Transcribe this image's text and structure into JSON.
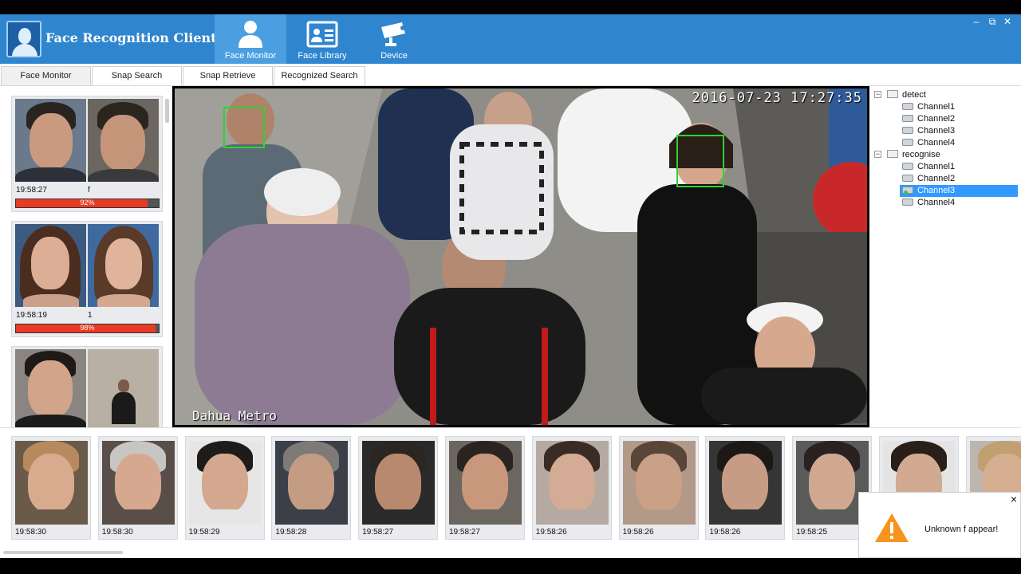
{
  "app": {
    "title": "Face Recognition Client"
  },
  "nav": [
    {
      "label": "Face Monitor",
      "icon": "person-icon",
      "active": true
    },
    {
      "label": "Face Library",
      "icon": "id-card-icon",
      "active": false
    },
    {
      "label": "Device",
      "icon": "camera-icon",
      "active": false
    }
  ],
  "window_controls": {
    "minimize": "–",
    "restore": "⧉",
    "close": "✕"
  },
  "tabs": [
    "Face Monitor",
    "Snap Search",
    "Snap Retrieve",
    "Recognized Search"
  ],
  "recognitions": [
    {
      "time": "19:58:27",
      "id": "f",
      "similarity": "92%",
      "similarity_value": 0.92
    },
    {
      "time": "19:58:19",
      "id": "1",
      "similarity": "98%",
      "similarity_value": 0.98
    },
    {
      "time": "",
      "id": "",
      "similarity": "",
      "similarity_value": 0
    }
  ],
  "video": {
    "timestamp": "2016-07-23 17:27:35",
    "label": "Dahua Metro"
  },
  "tree": {
    "groups": [
      {
        "name": "detect",
        "expander": "−",
        "channels": [
          "Channel1",
          "Channel2",
          "Channel3",
          "Channel4"
        ]
      },
      {
        "name": "recognise",
        "expander": "−",
        "channels": [
          "Channel1",
          "Channel2",
          "Channel3",
          "Channel4"
        ]
      }
    ],
    "selected": "recognise/Channel3"
  },
  "snapshots": [
    "19:58:30",
    "19:58:30",
    "19:58:29",
    "19:58:28",
    "19:58:27",
    "19:58:27",
    "19:58:26",
    "19:58:26",
    "19:58:26",
    "19:58:25",
    "",
    ""
  ],
  "notification": {
    "message": "Unknown f appear!",
    "close": "×",
    "icon": "warning-icon"
  },
  "colors": {
    "titlebar": "#2f86cf",
    "active_nav": "#4b9fe0",
    "bar_fill": "#ea3a24",
    "selection": "#3399ff",
    "face_box": "#2fd32f",
    "warning": "#f7941d"
  }
}
